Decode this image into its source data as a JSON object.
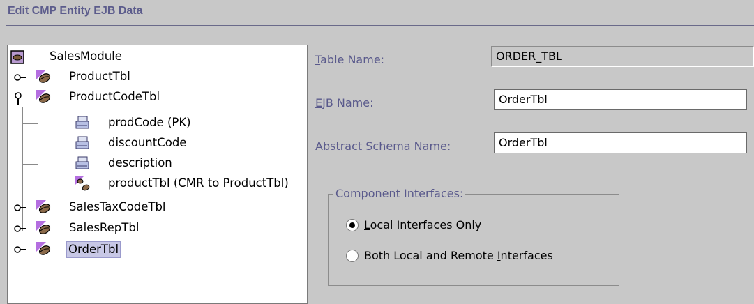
{
  "header": {
    "title": "Edit CMP Entity EJB Data"
  },
  "tree": {
    "root": {
      "label": "SalesModule",
      "icon": "module-icon"
    },
    "nodes": [
      {
        "label": "ProductTbl",
        "icon": "entity-bean-icon",
        "expanded": false
      },
      {
        "label": "ProductCodeTbl",
        "icon": "entity-bean-icon",
        "expanded": true,
        "children": [
          {
            "label": "prodCode (PK)",
            "icon": "cmp-field-icon"
          },
          {
            "label": "discountCode",
            "icon": "cmp-field-icon"
          },
          {
            "label": "description",
            "icon": "cmp-field-icon"
          },
          {
            "label": "productTbl (CMR to ProductTbl)",
            "icon": "cmr-field-icon"
          }
        ]
      },
      {
        "label": "SalesTaxCodeTbl",
        "icon": "entity-bean-icon",
        "expanded": false
      },
      {
        "label": "SalesRepTbl",
        "icon": "entity-bean-icon",
        "expanded": false
      },
      {
        "label": "OrderTbl",
        "icon": "entity-bean-icon",
        "expanded": false,
        "selected": true
      }
    ]
  },
  "form": {
    "table_name": {
      "label_mnemonic": "T",
      "label_rest": "able Name:",
      "value": "ORDER_TBL",
      "editable": false
    },
    "ejb_name": {
      "label_mnemonic": "E",
      "label_rest": "JB Name:",
      "value": "OrderTbl",
      "editable": true
    },
    "schema_name": {
      "label_mnemonic": "A",
      "label_rest": "bstract Schema Name:",
      "value": "OrderTbl",
      "editable": true
    },
    "component_interfaces": {
      "legend": "Component Interfaces:",
      "options": [
        {
          "mnemonic": "L",
          "rest": "ocal Interfaces Only",
          "selected": true
        },
        {
          "prefix": "Both Local and Remote ",
          "mnemonic": "I",
          "rest": "nterfaces",
          "selected": false
        }
      ]
    }
  },
  "colors": {
    "background": "#c8c8c8",
    "label": "#5a5a8c",
    "title": "#5c5c8c",
    "selection": "#c8c8e6"
  }
}
